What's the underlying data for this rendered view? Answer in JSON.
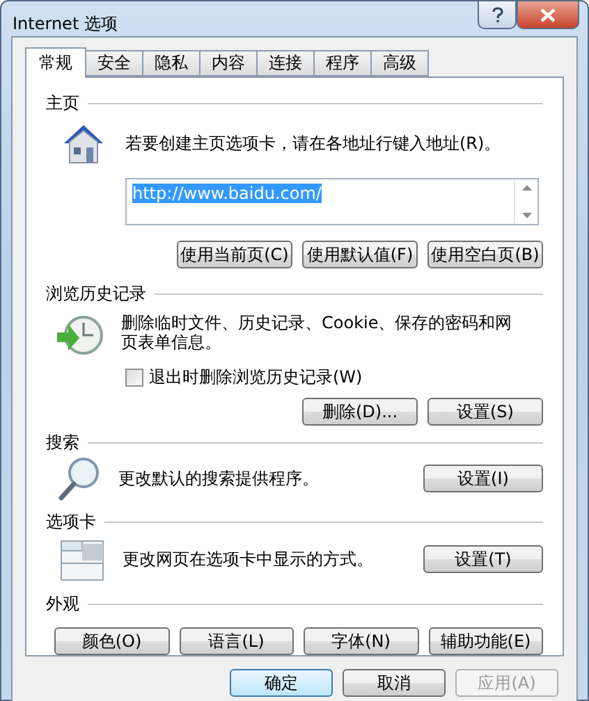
{
  "window": {
    "title": "Internet 选项"
  },
  "tabs": [
    {
      "label": "常规",
      "selected": true
    },
    {
      "label": "安全",
      "selected": false
    },
    {
      "label": "隐私",
      "selected": false
    },
    {
      "label": "内容",
      "selected": false
    },
    {
      "label": "连接",
      "selected": false
    },
    {
      "label": "程序",
      "selected": false
    },
    {
      "label": "高级",
      "selected": false
    }
  ],
  "home": {
    "heading": "主页",
    "description": "若要创建主页选项卡，请在各地址行键入地址(R)。",
    "address": {
      "value": "http://www.baidu.com/",
      "selected": true
    },
    "buttons": [
      "使用当前页(C)",
      "使用默认值(F)",
      "使用空白页(B)"
    ]
  },
  "history": {
    "heading": "浏览历史记录",
    "description": "删除临时文件、历史记录、Cookie、保存的密码和网页表单信息。",
    "checkbox": {
      "label": "退出时删除浏览历史记录(W)",
      "checked": false
    },
    "buttons": [
      "删除(D)...",
      "设置(S)"
    ]
  },
  "search": {
    "heading": "搜索",
    "description": "更改默认的搜索提供程序。",
    "button": "设置(I)"
  },
  "tabs_section": {
    "heading": "选项卡",
    "description": "更改网页在选项卡中显示的方式。",
    "button": "设置(T)"
  },
  "appearance": {
    "heading": "外观",
    "buttons": [
      "颜色(O)",
      "语言(L)",
      "字体(N)",
      "辅助功能(E)"
    ]
  },
  "footer": [
    {
      "label": "确定",
      "disabled": false,
      "default": true
    },
    {
      "label": "取消",
      "disabled": false,
      "default": false
    },
    {
      "label": "应用(A)",
      "disabled": true,
      "default": false
    }
  ]
}
